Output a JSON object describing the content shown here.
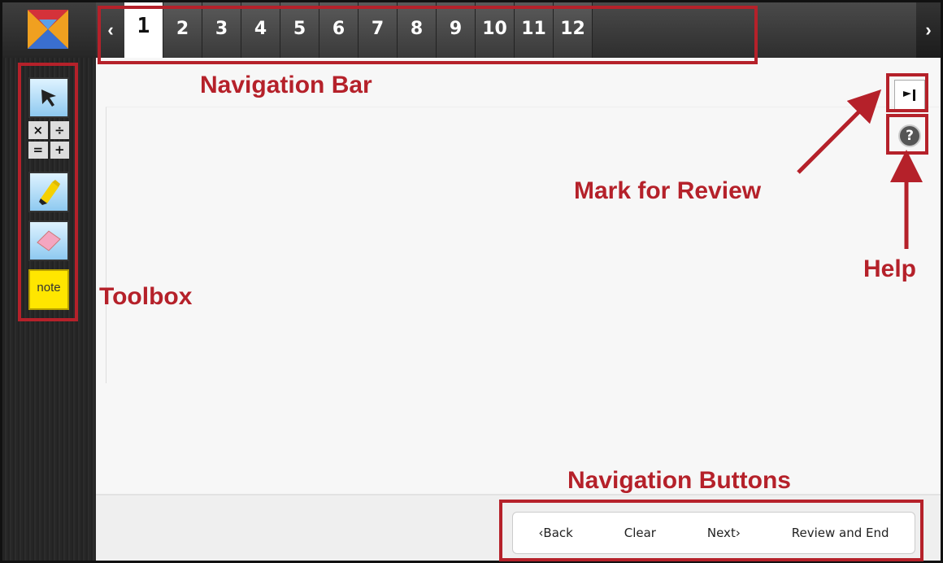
{
  "nav": {
    "prev_arrow": "‹",
    "next_arrow": "›",
    "questions": [
      "1",
      "2",
      "3",
      "4",
      "5",
      "6",
      "7",
      "8",
      "9",
      "10",
      "11",
      "12"
    ],
    "active_question": "1"
  },
  "toolbox": {
    "tools": [
      {
        "name": "pointer-tool",
        "icon": "arrow-cursor-icon"
      },
      {
        "name": "calculator-tool",
        "keys": [
          "×",
          "÷",
          "=",
          "+"
        ]
      },
      {
        "name": "highlighter-tool",
        "icon": "highlighter-icon"
      },
      {
        "name": "eraser-tool",
        "icon": "eraser-icon"
      },
      {
        "name": "note-tool",
        "label": "note"
      }
    ]
  },
  "right_tools": {
    "flag_icon": "flag-icon",
    "help_symbol": "?"
  },
  "buttons": {
    "back": "‹Back",
    "clear": "Clear",
    "next": "Next›",
    "review_end": "Review and End"
  },
  "annotations": {
    "navigation_bar": "Navigation Bar",
    "mark_for_review": "Mark for Review",
    "help": "Help",
    "toolbox": "Toolbox",
    "navigation_buttons": "Navigation Buttons"
  },
  "colors": {
    "annotation": "#b5212a",
    "note_yellow": "#ffe600",
    "tool_blue": "#8ec9f0"
  }
}
